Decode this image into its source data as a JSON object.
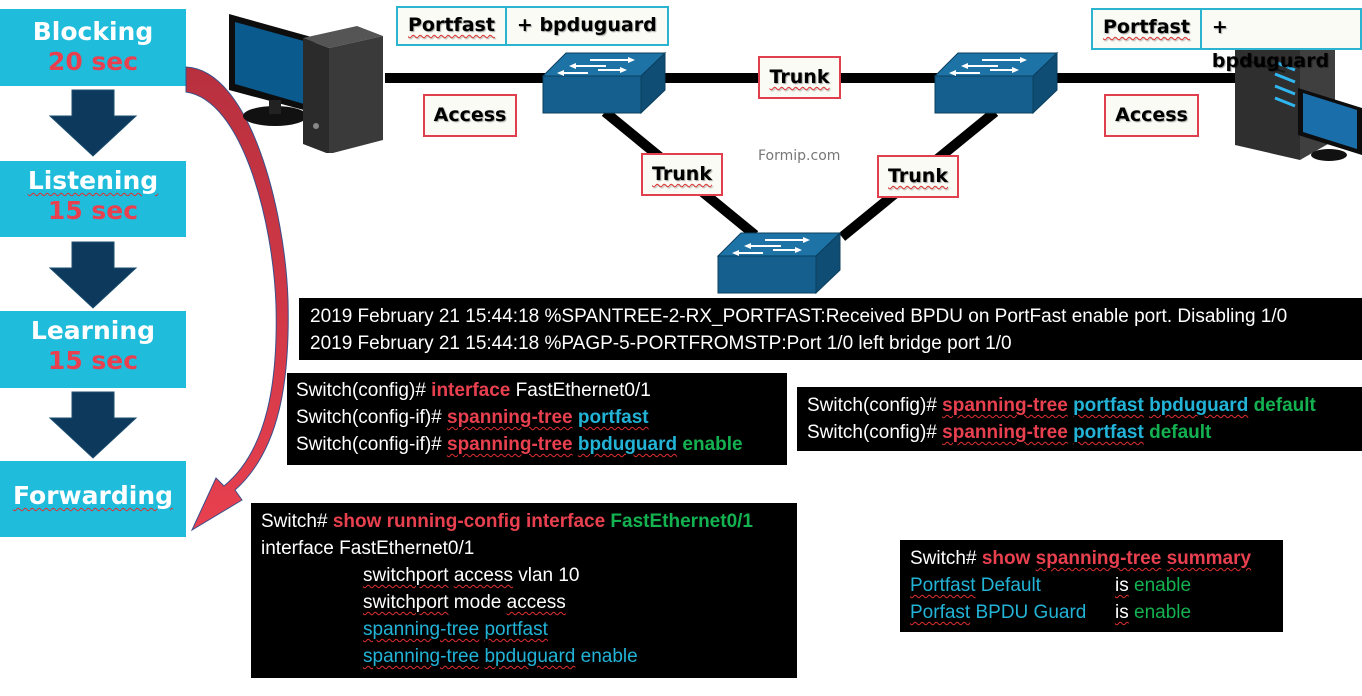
{
  "stp_states": [
    {
      "name": "Blocking",
      "time": "20 sec"
    },
    {
      "name": "Listening",
      "time": "15 sec"
    },
    {
      "name": "Learning",
      "time": "15 sec"
    },
    {
      "name": "Forwarding",
      "time": ""
    }
  ],
  "colors": {
    "stage_bg": "#1fbcdc",
    "stage_time": "#e8404f",
    "arrow_dark": "#0d3a5c",
    "bypass_arrow": "#e8404f",
    "switch_blue": "#1a6a9a",
    "tag_red_border": "#e0404e",
    "tag_cyan_border": "#2ab4cf",
    "cmd_red": "#e8404f",
    "cmd_cyan": "#22b3d6",
    "cmd_green": "#13b150"
  },
  "topology": {
    "left_port_features": [
      "Portfast",
      "+ bpduguard"
    ],
    "right_port_features": [
      "Portfast",
      "+ bpduguard"
    ],
    "left_link": "Access",
    "right_link": "Access",
    "top_trunk": "Trunk",
    "left_trunk": "Trunk",
    "right_trunk": "Trunk",
    "watermark": "Formip.com"
  },
  "log": {
    "lines": [
      "2019 February 21 15:44:18 %SPANTREE-2-RX_PORTFAST:Received BPDU on PortFast enable port. Disabling 1/0",
      "2019 February 21 15:44:18 %PAGP-5-PORTFROMSTP:Port 1/0 left bridge port 1/0"
    ]
  },
  "interface_config": {
    "l1_prompt": "Switch(config)# ",
    "l1_cmd": "interface",
    "l1_arg": " FastEthernet0/1",
    "l2_prompt": "Switch(config-if)# ",
    "l2_cmd": "spanning-tree",
    "l2_arg": "portfast",
    "l3_prompt": "Switch(config-if)# ",
    "l3_cmd": "spanning-tree",
    "l3_arg": "bpduguard",
    "l3_val": "enable"
  },
  "global_config": {
    "l1_prompt": "Switch(config)# ",
    "l1_cmd": "spanning-tree",
    "l1_arg1": "portfast",
    "l1_arg2": "bpduguard",
    "l1_val": "default",
    "l2_prompt": "Switch(config)# ",
    "l2_cmd": "spanning-tree",
    "l2_arg1": "portfast",
    "l2_val": "default"
  },
  "running_config": {
    "prompt": "Switch# ",
    "cmd": "show running-config interface",
    "arg": " FastEthernet0/1",
    "iface": "interface FastEthernet0/1",
    "sp_access_a": "switchport",
    "sp_access_b": "access",
    "sp_access_c": " vlan 10",
    "sp_mode_a": "switchport",
    "sp_mode_b": " mode ",
    "sp_mode_c": "access",
    "st_pf_a": "spanning-tree",
    "st_pf_b": "portfast",
    "st_bg_a": "spanning-tree",
    "st_bg_b": "bpduguard",
    "st_bg_c": " enable"
  },
  "summary": {
    "prompt": "Switch# ",
    "cmd_show": "show",
    "cmd_st": "spanning-tree",
    "cmd_sum": "summary",
    "r1_a": "Portfast",
    "r1_b": " Default",
    "r1_is": "is",
    "r1_val": "enable",
    "r2_a": "Porfast",
    "r2_b": " BPDU Guard",
    "r2_is": "is",
    "r2_val": "enable"
  }
}
